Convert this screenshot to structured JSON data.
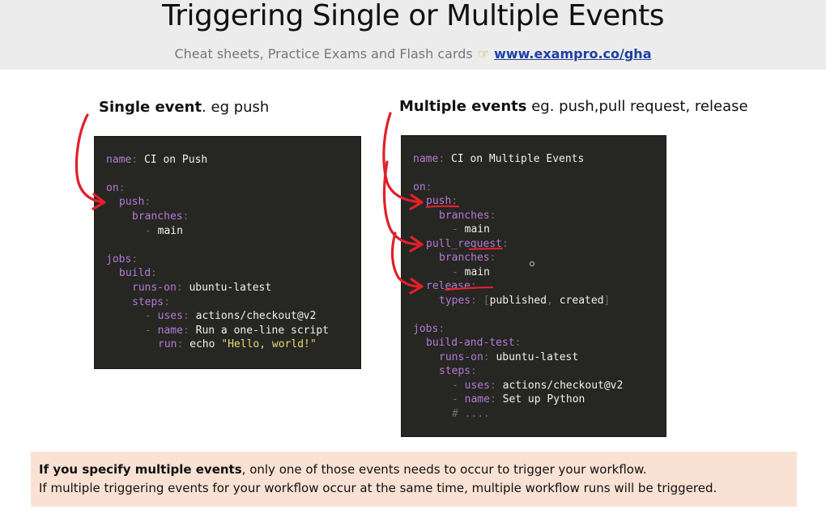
{
  "header": {
    "title": "Triggering Single or Multiple Events",
    "subtitle_text": "Cheat sheets, Practice Exams and Flash cards",
    "hand_icon": "pointing-hand-icon",
    "link_text": "www.exampro.co/gha"
  },
  "single": {
    "label_bold": "Single event",
    "label_rest": ". eg push",
    "code": {
      "l1_k": "name",
      "l1_v": "CI on Push",
      "l2_k": "on",
      "l3_k": "push",
      "l4_k": "branches",
      "l5_v": "main",
      "l6_k": "jobs",
      "l7_k": "build",
      "l8_k": "runs-on",
      "l8_v": "ubuntu-latest",
      "l9_k": "steps",
      "l10_k": "uses",
      "l10_v": "actions/checkout@v2",
      "l11_k": "name",
      "l11_v": "Run a one-line script",
      "l12_k": "run",
      "l12_v1": "echo ",
      "l12_v2": "\"Hello, world!\""
    }
  },
  "multiple": {
    "label_bold": "Multiple events",
    "label_rest": " eg. push,pull request, release",
    "code": {
      "l1_k": "name",
      "l1_v": "CI on Multiple Events",
      "l2_k": "on",
      "l3_k": "push",
      "l4_k": "branches",
      "l5_v": "main",
      "l6_k": "pull_request",
      "l7_k": "branches",
      "l8_v": "main",
      "l9_k": "release",
      "l10_k": "types",
      "l10_v1": "published",
      "l10_v2": "created",
      "l11_k": "jobs",
      "l12_k": "build-and-test",
      "l13_k": "runs-on",
      "l13_v": "ubuntu-latest",
      "l14_k": "steps",
      "l15_k": "uses",
      "l15_v": "actions/checkout@v2",
      "l16_k": "name",
      "l16_v": "Set up Python",
      "l17_c": "# ...."
    }
  },
  "note": {
    "bold": "If you specify multiple events",
    "rest": ", only one of those events needs to occur to trigger your workflow.",
    "line2": "If multiple triggering events for your workflow occur at the same time, multiple workflow runs will be triggered."
  },
  "colors": {
    "code_bg": "#262622",
    "key": "#b47ad8",
    "string": "#e6db74",
    "annotation": "#e0202a",
    "note_bg": "#f9e1d3",
    "link": "#1f3fa0"
  }
}
